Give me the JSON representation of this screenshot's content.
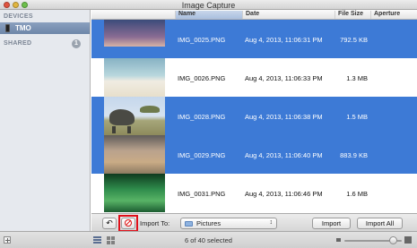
{
  "window": {
    "title": "Image Capture"
  },
  "sidebar": {
    "devices_header": "DEVICES",
    "device_label": "TMO",
    "shared_header": "SHARED",
    "shared_count": "1"
  },
  "columns": {
    "name": "Name",
    "date": "Date",
    "file_size": "File Size",
    "aperture": "Aperture"
  },
  "rows": [
    {
      "name": "IMG_0025.PNG",
      "date": "Aug 4, 2013, 11:06:31 PM",
      "size": "792.5 KB",
      "selected": true
    },
    {
      "name": "IMG_0026.PNG",
      "date": "Aug 4, 2013, 11:06:33 PM",
      "size": "1.3 MB",
      "selected": false
    },
    {
      "name": "IMG_0028.PNG",
      "date": "Aug 4, 2013, 11:06:38 PM",
      "size": "1.5 MB",
      "selected": true
    },
    {
      "name": "IMG_0029.PNG",
      "date": "Aug 4, 2013, 11:06:40 PM",
      "size": "883.9 KB",
      "selected": true
    },
    {
      "name": "IMG_0031.PNG",
      "date": "Aug 4, 2013, 11:06:46 PM",
      "size": "1.6 MB",
      "selected": false
    }
  ],
  "import_bar": {
    "import_to_label": "Import To:",
    "destination": "Pictures",
    "import_button": "Import",
    "import_all_button": "Import All"
  },
  "status": {
    "selection": "6 of 40 selected"
  },
  "colors": {
    "selection": "#3d7ad6",
    "delete_highlight": "#e0101a"
  },
  "icons": [
    "device-icon",
    "rotate-icon",
    "delete-icon",
    "folder-icon",
    "updown-icon",
    "list-view-icon",
    "grid-view-icon",
    "add-icon"
  ]
}
